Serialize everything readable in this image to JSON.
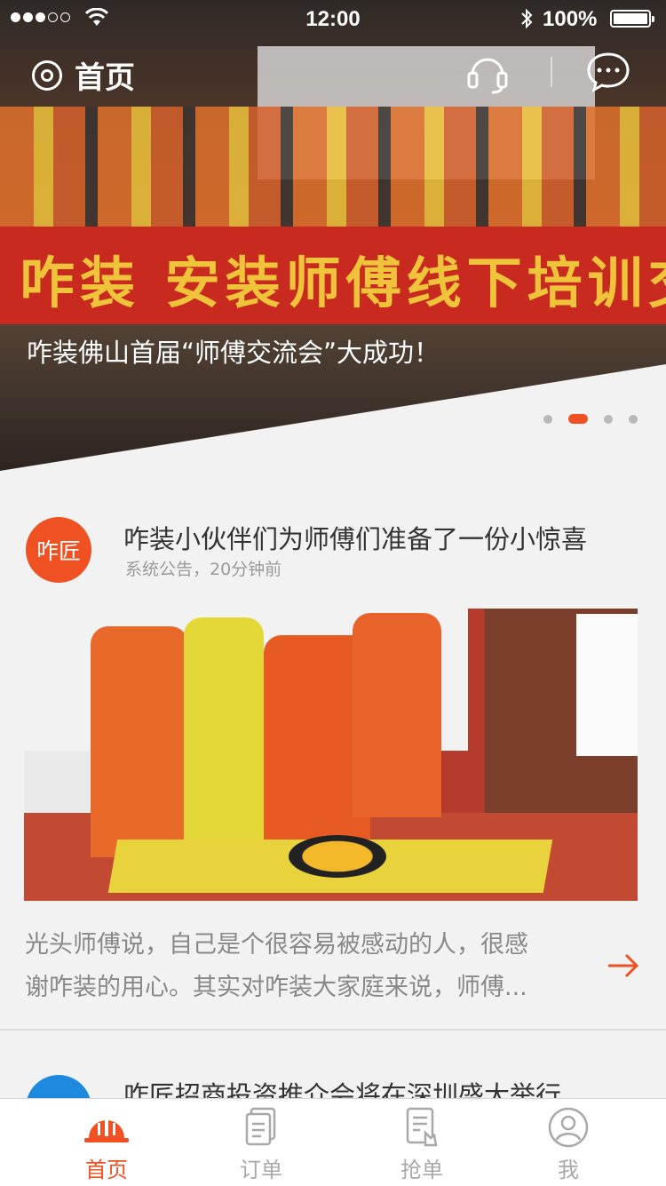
{
  "status_bar": {
    "time": "12:00",
    "battery": "100%"
  },
  "nav": {
    "title": "首页"
  },
  "banner": {
    "banner_text": "咋装 安装师傅线下培训交",
    "caption": "咋装佛山首届“师傅交流会”大成功！",
    "pages": 4,
    "active_page": 2
  },
  "post": {
    "avatar_text": "咋匠",
    "title": "咋装小伙伴们为师傅们准备了一份小惊喜",
    "meta": "系统公告，20分钟前",
    "body_line1": "光头师傅说，自己是个很容易被感动的人，很感",
    "body_line2": "谢咋装的用心。其实对咋装大家庭来说，师傅..."
  },
  "post2": {
    "title": "咋匠招商投资推介会将在深圳盛大举行"
  },
  "tabs": [
    {
      "label": "首页",
      "icon": "helmet-icon",
      "active": true
    },
    {
      "label": "订单",
      "icon": "document-stack-icon",
      "active": false
    },
    {
      "label": "抢单",
      "icon": "document-tap-icon",
      "active": false
    },
    {
      "label": "我",
      "icon": "user-icon",
      "active": false
    }
  ],
  "colors": {
    "accent": "#f05123",
    "blue": "#1d8ae0",
    "text": "#333333",
    "muted": "#9a9a9a"
  }
}
